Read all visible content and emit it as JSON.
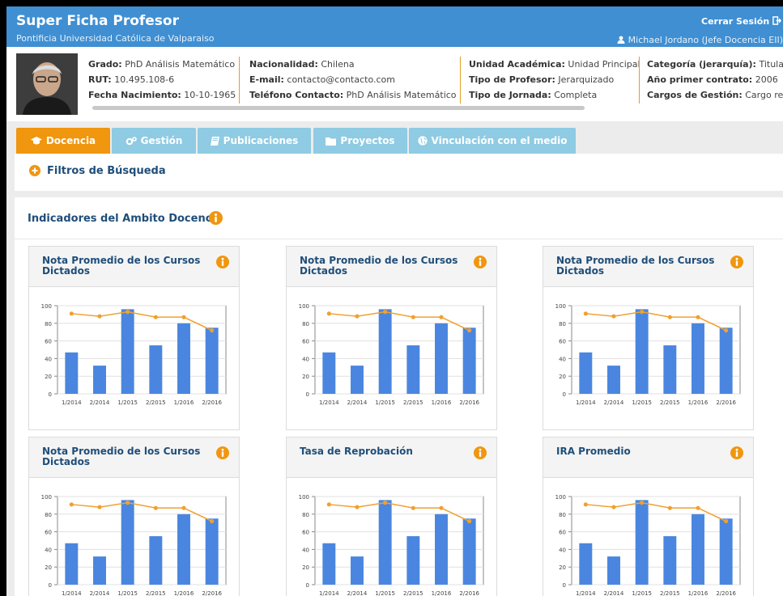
{
  "app": {
    "title": "Super Ficha Profesor",
    "subtitle": "Pontificia Universidad Católica de Valparaiso",
    "logout_label": "Cerrar Sesión",
    "user_label": "Michael Jordano (Jefe Docencia EII)"
  },
  "profile": {
    "col1": {
      "grado_label": "Grado:",
      "grado_value": "PhD Análisis Matemático",
      "rut_label": "RUT:",
      "rut_value": "10.495.108-6",
      "fecha_label": "Fecha Nacimiento:",
      "fecha_value": "10-10-1965"
    },
    "col2": {
      "nac_label": "Nacionalidad:",
      "nac_value": "Chilena",
      "email_label": "E-mail:",
      "email_value": "contacto@contacto.com",
      "tel_label": "Teléfono Contacto:",
      "tel_value": "PhD Análisis Matemático"
    },
    "col3": {
      "unidad_label": "Unidad Académica:",
      "unidad_value": "Unidad Principal",
      "tipo_label": "Tipo de Profesor:",
      "tipo_value": "Jerarquizado",
      "jornada_label": "Tipo de Jornada:",
      "jornada_value": "Completa"
    },
    "col4": {
      "cat_label": "Categoría (jerarquía):",
      "cat_value": "Titular",
      "anio_label": "Año primer contrato:",
      "anio_value": "2006",
      "cargos_label": "Cargos de Gestión:",
      "cargos_value": "Cargo re"
    }
  },
  "tabs": [
    {
      "label": "Docencia",
      "icon": "graduation-cap-icon"
    },
    {
      "label": "Gestión",
      "icon": "cogs-icon"
    },
    {
      "label": "Publicaciones",
      "icon": "book-icon"
    },
    {
      "label": "Proyectos",
      "icon": "folder-icon"
    },
    {
      "label": "Vinculación con el medio",
      "icon": "globe-icon"
    }
  ],
  "filters": {
    "title": "Filtros de Búsqueda"
  },
  "indicators": {
    "title": "Indicadores del Ambito Docencia",
    "cards": [
      {
        "title": "Nota Promedio de los Cursos Dictados"
      },
      {
        "title": "Nota Promedio de los Cursos Dictados"
      },
      {
        "title": "Nota Promedio de los Cursos Dictados"
      },
      {
        "title": "Nota Promedio de los Cursos Dictados"
      },
      {
        "title": "Tasa de Reprobación"
      },
      {
        "title": "IRA Promedio"
      }
    ]
  },
  "colors": {
    "header": "#3f8fd2",
    "tab_active": "#f0960f",
    "tab_inactive": "#8fcbe3",
    "bar": "#4a86e0",
    "line": "#f0a030"
  },
  "chart_data": [
    {
      "type": "bar",
      "categories": [
        "1/2014",
        "2/2014",
        "1/2015",
        "2/2015",
        "1/2016",
        "2/2016"
      ],
      "series": [
        {
          "type": "bar",
          "values": [
            47,
            32,
            96,
            55,
            80,
            75
          ]
        },
        {
          "type": "line",
          "values": [
            91,
            88,
            93,
            87,
            87,
            72
          ]
        }
      ],
      "yticks": [
        0,
        20,
        40,
        60,
        80,
        100
      ],
      "ylim": [
        0,
        100
      ]
    },
    {
      "type": "bar",
      "categories": [
        "1/2014",
        "2/2014",
        "1/2015",
        "2/2015",
        "1/2016",
        "2/2016"
      ],
      "series": [
        {
          "type": "bar",
          "values": [
            47,
            32,
            96,
            55,
            80,
            75
          ]
        },
        {
          "type": "line",
          "values": [
            91,
            88,
            93,
            87,
            87,
            72
          ]
        }
      ],
      "yticks": [
        0,
        20,
        40,
        60,
        80,
        100
      ],
      "ylim": [
        0,
        100
      ]
    },
    {
      "type": "bar",
      "categories": [
        "1/2014",
        "2/2014",
        "1/2015",
        "2/2015",
        "1/2016",
        "2/2016"
      ],
      "series": [
        {
          "type": "bar",
          "values": [
            47,
            32,
            96,
            55,
            80,
            75
          ]
        },
        {
          "type": "line",
          "values": [
            91,
            88,
            93,
            87,
            87,
            72
          ]
        }
      ],
      "yticks": [
        0,
        20,
        40,
        60,
        80,
        100
      ],
      "ylim": [
        0,
        100
      ]
    },
    {
      "type": "bar",
      "categories": [
        "1/2014",
        "2/2014",
        "1/2015",
        "2/2015",
        "1/2016",
        "2/2016"
      ],
      "series": [
        {
          "type": "bar",
          "values": [
            47,
            32,
            96,
            55,
            80,
            75
          ]
        },
        {
          "type": "line",
          "values": [
            91,
            88,
            93,
            87,
            87,
            72
          ]
        }
      ],
      "yticks": [
        0,
        20,
        40,
        60,
        80,
        100
      ],
      "ylim": [
        0,
        100
      ]
    },
    {
      "type": "bar",
      "categories": [
        "1/2014",
        "2/2014",
        "1/2015",
        "2/2015",
        "1/2016",
        "2/2016"
      ],
      "series": [
        {
          "type": "bar",
          "values": [
            47,
            32,
            96,
            55,
            80,
            75
          ]
        },
        {
          "type": "line",
          "values": [
            91,
            88,
            93,
            87,
            87,
            72
          ]
        }
      ],
      "yticks": [
        0,
        20,
        40,
        60,
        80,
        100
      ],
      "ylim": [
        0,
        100
      ]
    },
    {
      "type": "bar",
      "categories": [
        "1/2014",
        "2/2014",
        "1/2015",
        "2/2015",
        "1/2016",
        "2/2016"
      ],
      "series": [
        {
          "type": "bar",
          "values": [
            47,
            32,
            96,
            55,
            80,
            75
          ]
        },
        {
          "type": "line",
          "values": [
            91,
            88,
            93,
            87,
            87,
            72
          ]
        }
      ],
      "yticks": [
        0,
        20,
        40,
        60,
        80,
        100
      ],
      "ylim": [
        0,
        100
      ]
    }
  ]
}
